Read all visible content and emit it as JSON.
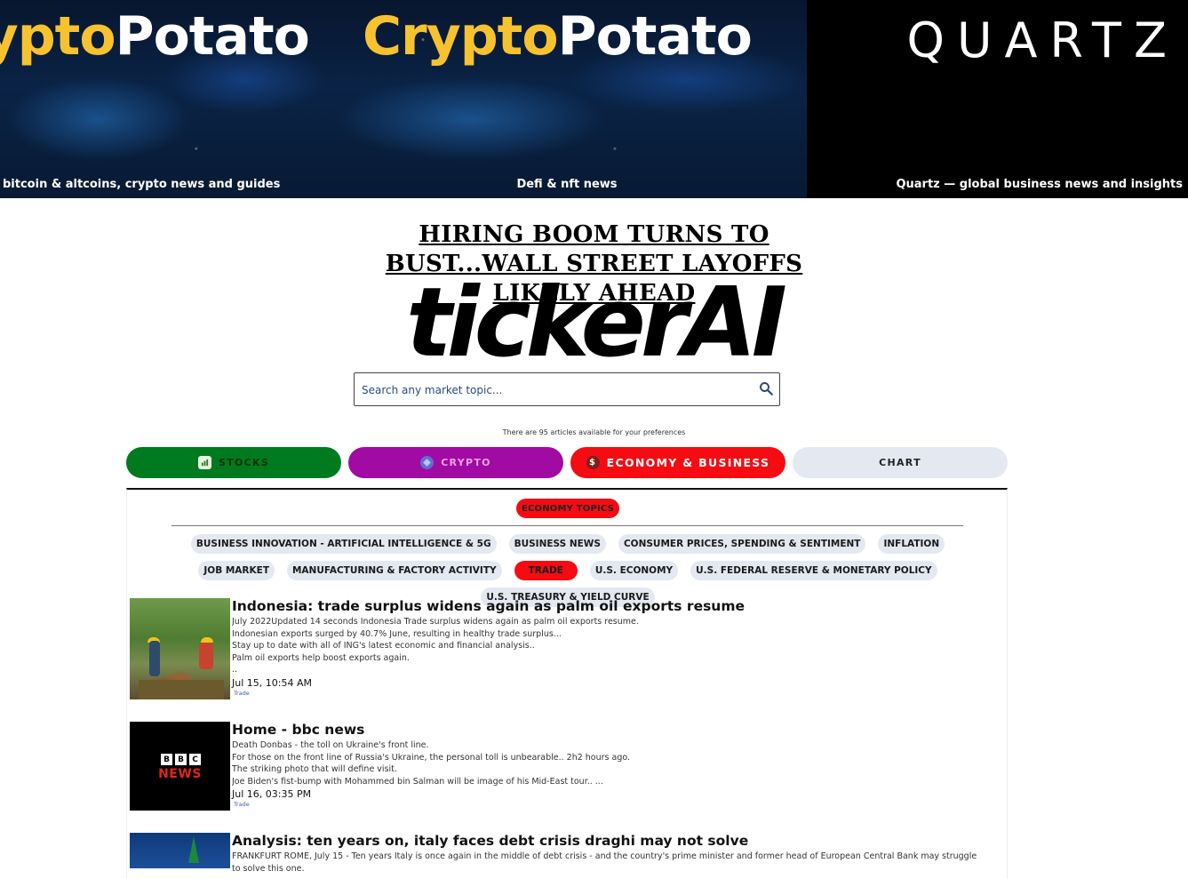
{
  "banner": {
    "panels": [
      {
        "logo_yellow": "Crypto",
        "logo_white": "Potato",
        "caption": "bitcoin & altcoins, crypto news and guides"
      },
      {
        "logo_yellow": "Crypto",
        "logo_white": "Potato",
        "caption": "Defi & nft news"
      },
      {
        "logo": "QUARTZ",
        "caption": "Quartz — global business news and insights"
      }
    ]
  },
  "headline": "HIRING BOOM TURNS TO BUST...WALL STREET LAYOFFS LIKELY AHEAD",
  "site_logo": "tickerAI",
  "search": {
    "placeholder": "Search any market topic...",
    "icon": "search-icon"
  },
  "available_text": "There are 95 articles available for your preferences",
  "tabs": [
    {
      "label": "STOCKS",
      "icon": "chart-bar-icon",
      "color": "#007a1f"
    },
    {
      "label": "CRYPTO",
      "icon": "coin-icon",
      "color": "#a10aa3"
    },
    {
      "label": "ECONOMY & BUSINESS",
      "icon": "dollar-icon",
      "color": "#f50b12",
      "active": true
    },
    {
      "label": "CHART",
      "color": "#e3e8f1"
    }
  ],
  "section_label": "ECONOMY TOPICS",
  "topics": [
    {
      "label": "BUSINESS INNOVATION - ARTIFICIAL INTELLIGENCE & 5G"
    },
    {
      "label": "BUSINESS NEWS"
    },
    {
      "label": "CONSUMER PRICES, SPENDING & SENTIMENT"
    },
    {
      "label": "INFLATION"
    },
    {
      "label": "JOB MARKET"
    },
    {
      "label": "MANUFACTURING & FACTORY ACTIVITY"
    },
    {
      "label": "TRADE",
      "active": true
    },
    {
      "label": "U.S. ECONOMY"
    },
    {
      "label": "U.S. FEDERAL RESERVE & MONETARY POLICY"
    },
    {
      "label": "U.S. TREASURY & YIELD CURVE"
    }
  ],
  "articles": [
    {
      "title": "Indonesia: trade surplus widens again as palm oil exports resume",
      "lines": [
        " July 2022Updated 14 seconds Indonesia Trade surplus widens again as palm oil exports resume.",
        "Indonesian exports surged by 40.7% June, resulting in healthy trade surplus...",
        "Stay up to date with all of ING's latest economic and financial analysis..",
        "Palm oil exports help boost exports again.",
        ".."
      ],
      "date": "Jul 15, 10:54 AM",
      "tag": "Trade"
    },
    {
      "title": "Home - bbc news",
      "lines": [
        "Death Donbas - the toll on Ukraine's front line.",
        "For those on the front line of Russia's Ukraine, the personal toll is unbearable.. 2h2 hours ago.",
        "The striking photo that will define visit.",
        "Joe Biden's fist-bump with Mohammed bin Salman will be image of his Mid-East tour.. ..."
      ],
      "date": "Jul 16, 03:35 PM",
      "tag": "Trade",
      "thumb_text": {
        "blocks": [
          "B",
          "B",
          "C"
        ],
        "word": "NEWS"
      }
    },
    {
      "title": "Analysis: ten years on, italy faces debt crisis draghi may not solve",
      "lines": [
        "FRANKFURT ROME, July 15 - Ten years Italy is once again in the middle of debt crisis - and the country's prime minister and former head of European Central Bank may struggle",
        "to solve this one."
      ]
    }
  ]
}
